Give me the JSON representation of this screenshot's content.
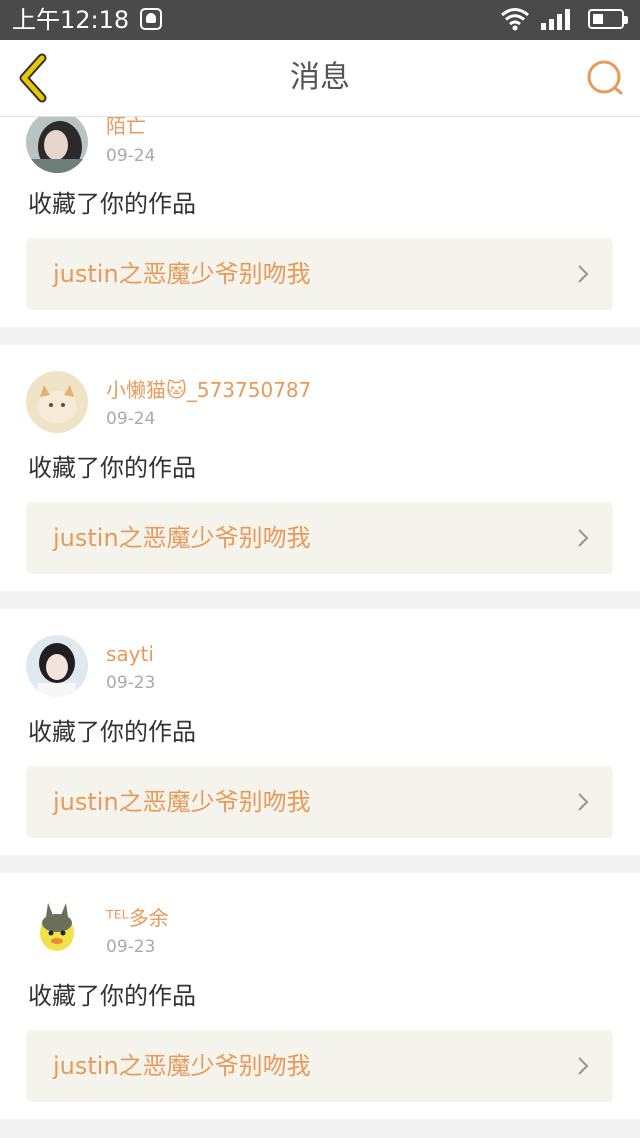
{
  "status_bar": {
    "time": "上午12:18"
  },
  "header": {
    "title": "消息",
    "back_icon": "chevron-left-icon",
    "search_icon": "search-icon"
  },
  "colors": {
    "accent": "#e89a5a",
    "back_arrow": "#e8c800",
    "card_link_bg": "#f4f3ec"
  },
  "notifications": [
    {
      "username": "陌亡",
      "date": "09-24",
      "action": "收藏了你的作品",
      "work_title": "justin之恶魔少爷别吻我"
    },
    {
      "username": "小懒猫🐱_573750787",
      "date": "09-24",
      "action": "收藏了你的作品",
      "work_title": "justin之恶魔少爷别吻我"
    },
    {
      "username": "sayti",
      "date": "09-23",
      "action": "收藏了你的作品",
      "work_title": "justin之恶魔少爷别吻我"
    },
    {
      "username": "ᵀᴱᴸ多余",
      "date": "09-23",
      "action": "收藏了你的作品",
      "work_title": "justin之恶魔少爷别吻我"
    }
  ]
}
